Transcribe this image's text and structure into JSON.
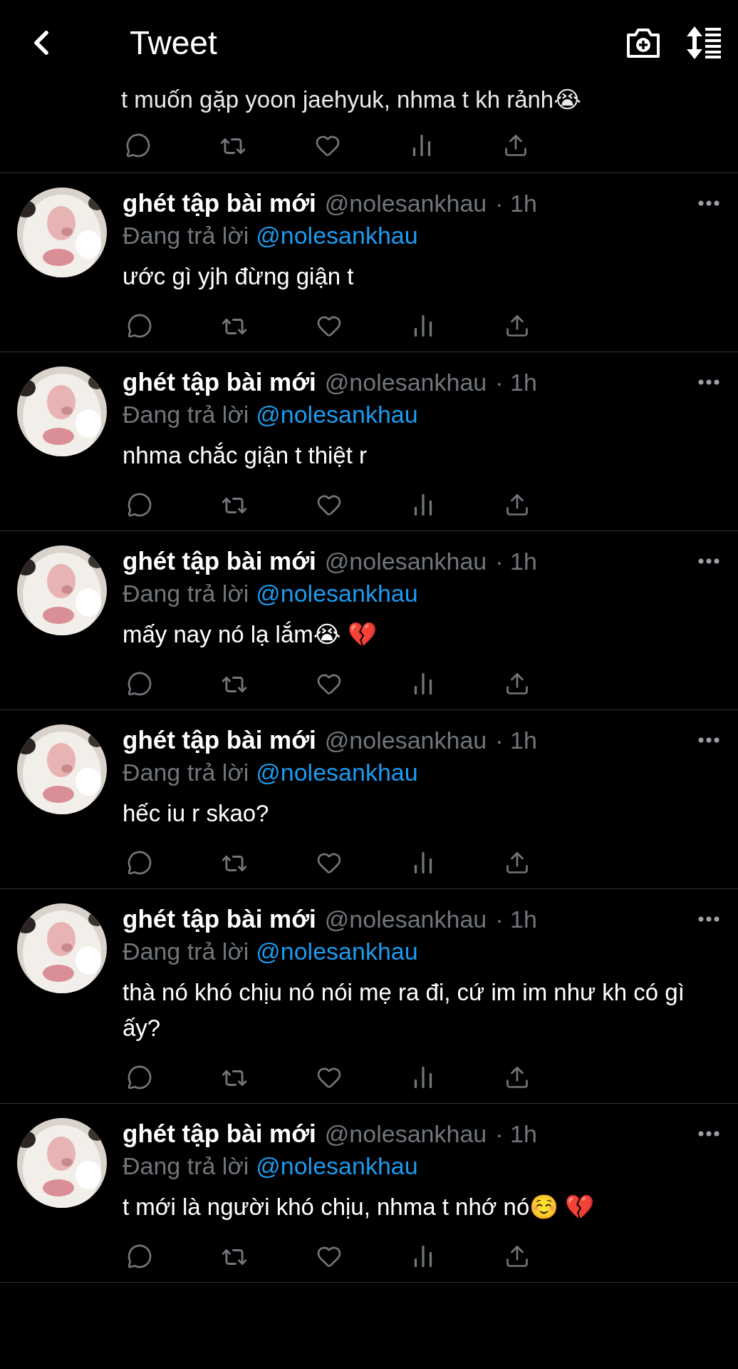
{
  "header": {
    "title": "Tweet"
  },
  "previous_tweet": {
    "text": "t muốn gặp yoon jaehyuk, nhma t kh rảnh😭"
  },
  "tweets": [
    {
      "name": "ghét tập bài mới",
      "handle": "@nolesankhau",
      "time": "· 1h",
      "reply_label": "Đang trả lời",
      "reply_to": "@nolesankhau",
      "text": "ước gì yjh đừng giận t"
    },
    {
      "name": "ghét tập bài mới",
      "handle": "@nolesankhau",
      "time": "· 1h",
      "reply_label": "Đang trả lời",
      "reply_to": "@nolesankhau",
      "text": "nhma chắc giận t thiệt r"
    },
    {
      "name": "ghét tập bài mới",
      "handle": "@nolesankhau",
      "time": "· 1h",
      "reply_label": "Đang trả lời",
      "reply_to": "@nolesankhau",
      "text": "mấy nay nó lạ lắm😭 💔"
    },
    {
      "name": "ghét tập bài mới",
      "handle": "@nolesankhau",
      "time": "· 1h",
      "reply_label": "Đang trả lời",
      "reply_to": "@nolesankhau",
      "text": "hếc iu r skao?"
    },
    {
      "name": "ghét tập bài mới",
      "handle": "@nolesankhau",
      "time": "· 1h",
      "reply_label": "Đang trả lời",
      "reply_to": "@nolesankhau",
      "text": "thà nó khó chịu nó nói mẹ ra đi, cứ im im như kh có gì ấy?"
    },
    {
      "name": "ghét tập bài mới",
      "handle": "@nolesankhau",
      "time": "· 1h",
      "reply_label": "Đang trả lời",
      "reply_to": "@nolesankhau",
      "text": "t mới là người khó chịu, nhma t nhớ nó☺️ 💔"
    }
  ]
}
